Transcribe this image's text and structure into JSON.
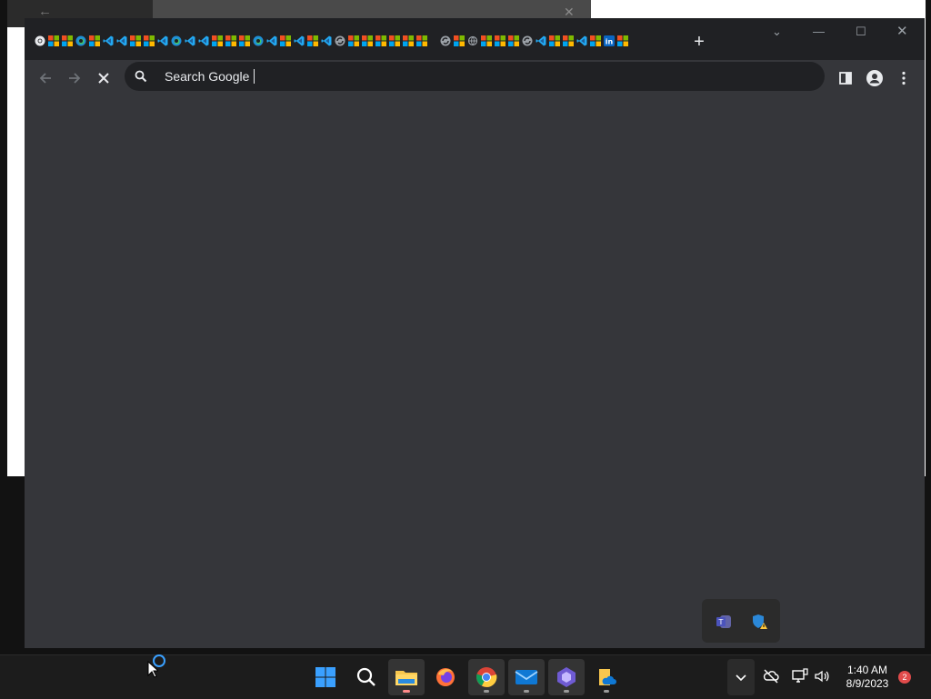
{
  "browser": {
    "tabs": [
      {
        "icon": "chrome-icon"
      },
      {
        "icon": "microsoft-icon"
      },
      {
        "icon": "microsoft-icon"
      },
      {
        "icon": "edge-icon"
      },
      {
        "icon": "microsoft-icon"
      },
      {
        "icon": "vscode-icon"
      },
      {
        "icon": "vscode-icon"
      },
      {
        "icon": "microsoft-icon"
      },
      {
        "icon": "microsoft-icon"
      },
      {
        "icon": "vscode-icon"
      },
      {
        "icon": "edge-icon"
      },
      {
        "icon": "vscode-icon"
      },
      {
        "icon": "vscode-icon"
      },
      {
        "icon": "microsoft-icon"
      },
      {
        "icon": "microsoft-icon"
      },
      {
        "icon": "microsoft-icon"
      },
      {
        "icon": "edge-icon"
      },
      {
        "icon": "vscode-icon"
      },
      {
        "icon": "microsoft-icon"
      },
      {
        "icon": "vscode-icon"
      },
      {
        "icon": "microsoft-icon"
      },
      {
        "icon": "vscode-icon"
      },
      {
        "icon": "sync-icon"
      },
      {
        "icon": "microsoft-icon"
      },
      {
        "icon": "microsoft-icon"
      },
      {
        "icon": "microsoft-icon"
      },
      {
        "icon": "microsoft-icon"
      },
      {
        "icon": "microsoft-icon"
      },
      {
        "icon": "microsoft-icon"
      },
      {
        "icon": "sync-icon"
      },
      {
        "icon": "microsoft-icon"
      },
      {
        "icon": "globe-icon"
      },
      {
        "icon": "microsoft-icon"
      },
      {
        "icon": "microsoft-icon"
      },
      {
        "icon": "microsoft-icon"
      },
      {
        "icon": "sync-icon"
      },
      {
        "icon": "vscode-icon"
      },
      {
        "icon": "microsoft-icon"
      },
      {
        "icon": "microsoft-icon"
      },
      {
        "icon": "vscode-icon"
      },
      {
        "icon": "microsoft-icon"
      },
      {
        "icon": "linkedin-icon"
      },
      {
        "icon": "microsoft-icon"
      }
    ],
    "new_tab_label": "+",
    "omnibox": {
      "text": "Search Google"
    }
  },
  "tray_popup": {
    "icons": [
      "teams-icon",
      "defender-warning-icon"
    ]
  },
  "taskbar": {
    "apps": [
      {
        "name": "start-button",
        "icon": "windows-logo-icon",
        "active": false,
        "running": false
      },
      {
        "name": "search-button",
        "icon": "search-icon",
        "active": false,
        "running": false
      },
      {
        "name": "file-explorer-button",
        "icon": "folder-icon",
        "active": true,
        "running": true
      },
      {
        "name": "firefox-button",
        "icon": "firefox-icon",
        "active": false,
        "running": false
      },
      {
        "name": "chrome-button",
        "icon": "chrome-icon",
        "active": true,
        "running": true
      },
      {
        "name": "mail-button",
        "icon": "mail-icon",
        "active": true,
        "running": true
      },
      {
        "name": "power-automate-button",
        "icon": "power-automate-icon",
        "active": true,
        "running": true
      },
      {
        "name": "onedrive-files-button",
        "icon": "onedrive-folder-icon",
        "active": false,
        "running": true
      }
    ],
    "clock": {
      "time": "1:40 AM",
      "date": "8/9/2023"
    },
    "notification_count": "2"
  },
  "colors": {
    "accent": "#3aa0ff",
    "window_bg": "#35363a",
    "tabstrip_bg": "#202124",
    "taskbar_bg": "#1c1c1c"
  }
}
